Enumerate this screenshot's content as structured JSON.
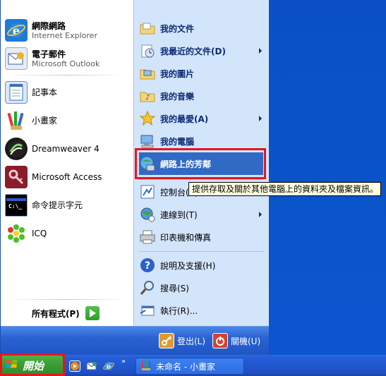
{
  "start_menu": {
    "pinned": [
      {
        "title": "網際網路",
        "subtitle": "Internet Explorer",
        "icon": "internet-explorer-icon"
      },
      {
        "title": "電子郵件",
        "subtitle": "Microsoft Outlook",
        "icon": "outlook-icon"
      }
    ],
    "recent_programs": [
      {
        "label": "記事本",
        "icon": "notepad-icon"
      },
      {
        "label": "小畫家",
        "icon": "paint-icon"
      },
      {
        "label": "Dreamweaver 4",
        "icon": "dreamweaver-icon"
      },
      {
        "label": "Microsoft Access",
        "icon": "access-icon"
      },
      {
        "label": "命令提示字元",
        "icon": "command-prompt-icon"
      },
      {
        "label": "ICQ",
        "icon": "icq-icon"
      }
    ],
    "all_programs_label": "所有程式(P)",
    "right_items": [
      {
        "label": "我的文件",
        "icon": "folder-icon",
        "bold": true,
        "submenu": false
      },
      {
        "label": "我最近的文件(D)",
        "icon": "recent-docs-icon",
        "bold": true,
        "submenu": true
      },
      {
        "label": "我的圖片",
        "icon": "pictures-icon",
        "bold": true,
        "submenu": false
      },
      {
        "label": "我的音樂",
        "icon": "music-icon",
        "bold": true,
        "submenu": false
      },
      {
        "label": "我的最愛(A)",
        "icon": "favorites-icon",
        "bold": true,
        "submenu": true
      },
      {
        "label": "我的電腦",
        "icon": "computer-icon",
        "bold": true,
        "submenu": false
      },
      {
        "label": "網路上的芳鄰",
        "icon": "network-icon",
        "bold": true,
        "submenu": false
      },
      {
        "label": "控制台(C)",
        "icon": "control-panel-icon",
        "bold": false,
        "submenu": false
      },
      {
        "label": "連線到(T)",
        "icon": "connect-icon",
        "bold": false,
        "submenu": true
      },
      {
        "label": "印表機和傳真",
        "icon": "printer-icon",
        "bold": false,
        "submenu": false
      },
      {
        "label": "說明及支援(H)",
        "icon": "help-icon",
        "bold": false,
        "submenu": false
      },
      {
        "label": "搜尋(S)",
        "icon": "search-icon",
        "bold": false,
        "submenu": false
      },
      {
        "label": "執行(R)...",
        "icon": "run-icon",
        "bold": false,
        "submenu": false
      }
    ],
    "tooltip": "提供存取及關於其他電腦上的資料夾及檔案資訊。",
    "logoff_label": "登出(L)",
    "shutdown_label": "關機(U)"
  },
  "taskbar": {
    "start_label": "開始",
    "quick_launch": [
      "media-player-icon",
      "outlook-express-icon",
      "internet-explorer-icon"
    ],
    "more_label": "»",
    "tasks": [
      {
        "label": "未命名 - 小畫家",
        "icon": "paint-icon"
      }
    ]
  },
  "colors": {
    "highlight": "#e8151d",
    "selection": "#316ac5",
    "taskbar": "#245edb",
    "start_button": "#3c9f36"
  }
}
